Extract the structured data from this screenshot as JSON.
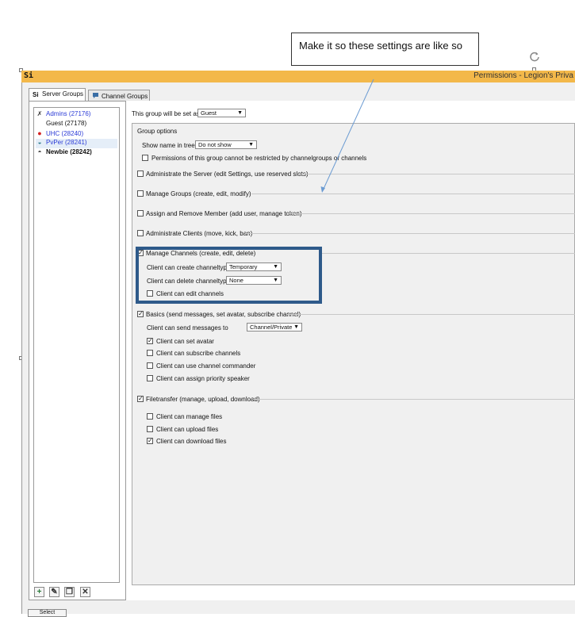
{
  "annotation": {
    "callout_text": "Make it so these settings are like so"
  },
  "window": {
    "title": "Permissions - Legion's Priva",
    "app_icon_text": "Si"
  },
  "tabs": [
    {
      "label": "Server Groups",
      "icon": "ts-icon",
      "active": true
    },
    {
      "label": "Channel Groups",
      "icon": "chat-bubble-icon",
      "active": false
    }
  ],
  "groups": [
    {
      "label": "Admins (27176)",
      "color": "#2b3bd6",
      "icon": "sword-icon",
      "glyph": "✗"
    },
    {
      "label": "Guest (27178)",
      "color": "#111111",
      "icon": "",
      "glyph": ""
    },
    {
      "label": "UHC (28240)",
      "color": "#2b3bd6",
      "icon": "apple-icon",
      "glyph": "●"
    },
    {
      "label": "PvPer (28241)",
      "color": "#2b3bd6",
      "icon": "helmet-icon",
      "glyph": "◒"
    },
    {
      "label": "Newbie (28242)",
      "color": "#111111",
      "icon": "newbie-icon",
      "glyph": "◓"
    }
  ],
  "bottom_toolbar": {
    "add": "+",
    "edit": "✎",
    "copy": "❐",
    "delete": "✕"
  },
  "bottom_button_label": "Select",
  "settings": {
    "set_as_label": "This group will be set as:",
    "set_as_value": "Guest",
    "group_options_title": "Group options",
    "show_name_label": "Show name in tree:",
    "show_name_value": "Do not show",
    "permissions_restrict_label": "Permissions of this group cannot be restricted by channelgroups or channels",
    "administrate_server": "Administrate the Server (edit Settings, use reserved slots)",
    "manage_groups": "Manage Groups (create, edit, modify)",
    "assign_member": "Assign and Remove Member (add user, manage token)",
    "administrate_clients": "Administrate Clients (move, kick, ban)",
    "manage_channels": "Manage Channels (create, edit, delete)",
    "create_channeltype_label": "Client can create channeltype",
    "create_channeltype_value": "Temporary",
    "delete_channeltype_label": "Client can delete channeltype",
    "delete_channeltype_value": "None",
    "edit_channels": "Client can edit channels",
    "basics": "Basics (send messages, set avatar, subscribe channel)",
    "send_messages_label": "Client can send messages to",
    "send_messages_value": "Channel/Private",
    "set_avatar": "Client can set avatar",
    "subscribe_channels": "Client can subscribe channels",
    "channel_commander": "Client can use channel commander",
    "priority_speaker": "Client can assign priority speaker",
    "filetransfer": "Filetransfer (manage, upload, download)",
    "manage_files": "Client can manage files",
    "upload_files": "Client can upload files",
    "download_files": "Client can download files",
    "check_mark": "✓"
  }
}
